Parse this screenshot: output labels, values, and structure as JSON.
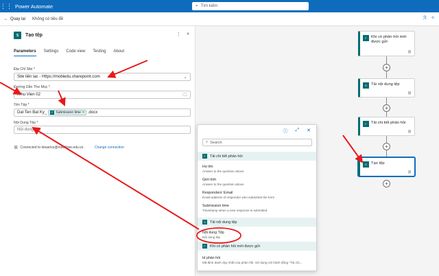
{
  "topbar": {
    "app_title": "Power Automate",
    "search_placeholder": "Tìm kiếm"
  },
  "cmdbar": {
    "back_label": "Quay lại",
    "flow_name": "Không có tiêu đề"
  },
  "panel": {
    "action_title": "Tạo tệp",
    "tabs": [
      "Parameters",
      "Settings",
      "Code view",
      "Testing",
      "About"
    ],
    "site_label": "Địa Chỉ Site *",
    "site_value": "Site liên lạc - Https://mobiedu.sharepoint.com",
    "folder_label": "Đường Dẫn Thư Mục *",
    "folder_value": "/Thu Vien 02",
    "filename_label": "Tên Tệp *",
    "filename_prefix": "Dat Ten Bat Ky_",
    "filename_token": "Submission time",
    "filename_suffix": ".docx",
    "content_label": "Nội Dung Tệp *",
    "content_value": "Nội dung tệp:",
    "connected_text": "Connected to letuanvu@mobifone.edu.vn.",
    "change_connection": "Change connection"
  },
  "popup": {
    "search_placeholder": "Search",
    "sections": [
      {
        "title": "Tải chi tiết phản hồi",
        "items": [
          {
            "title": "Họ tên",
            "desc": "Answer to the question above"
          },
          {
            "title": "Giới tính",
            "desc": "Answer to the question above"
          },
          {
            "title": "Responders' Email",
            "desc": "Email address of responder who submitted the form"
          },
          {
            "title": "Submission time",
            "desc": "Timestamp when a new response is submitted"
          }
        ]
      },
      {
        "title": "Tải nội dung tệp",
        "items": [
          {
            "title": "Nội dung Tệp",
            "desc": "Nội dung tệp"
          }
        ]
      },
      {
        "title": "Khi có phản hồi mới được gửi",
        "items": [
          {
            "title": "Id phản hồi",
            "desc": "Mã định danh duy nhất của phản hồi. Sử dụng với hành động \"Tải chi..."
          }
        ]
      }
    ]
  },
  "canvas": {
    "cards": [
      {
        "name": "Khi có phản hồi mới được gửi"
      },
      {
        "name": "Tải nội dung tệp"
      },
      {
        "name": "Tải chi tiết phản hồi"
      },
      {
        "name": "Tạo tệp"
      }
    ]
  },
  "colors": {
    "accent": "#0f6cbd",
    "sharepoint": "#036c70",
    "annotation": "#e8191a"
  },
  "icons": {
    "sharepoint": "S",
    "plus": "+"
  }
}
